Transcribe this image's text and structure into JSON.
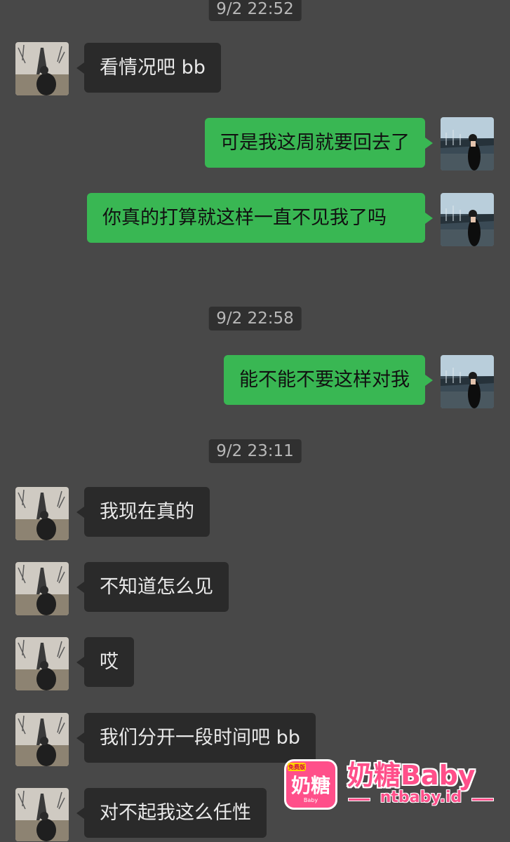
{
  "timestamps": [
    "9/2 22:52",
    "9/2 22:58",
    "9/2 23:11"
  ],
  "messages": [
    {
      "side": "in",
      "text": "看情况吧 bb"
    },
    {
      "side": "out",
      "text": "可是我这周就要回去了"
    },
    {
      "side": "out",
      "text": "你真的打算就这样一直不见我了吗"
    },
    {
      "side": "out",
      "text": "能不能不要这样对我"
    },
    {
      "side": "in",
      "text": "我现在真的"
    },
    {
      "side": "in",
      "text": "不知道怎么见"
    },
    {
      "side": "in",
      "text": "哎"
    },
    {
      "side": "in",
      "text": "我们分开一段时间吧 bb"
    },
    {
      "side": "in",
      "text": "对不起我这么任性"
    }
  ],
  "watermark": {
    "badge": "免费版",
    "logo_text": "奶糖",
    "logo_sub": "Baby",
    "title": "奶糖Baby",
    "url": "ntbaby.id"
  },
  "colors": {
    "background": "#484848",
    "incoming_bubble": "#2a2a2a",
    "outgoing_bubble": "#39b753",
    "watermark_pink": "#ff4f8a"
  },
  "avatars": {
    "incoming": "eiffel-tower-photo",
    "outgoing": "harbor-portrait-photo"
  }
}
